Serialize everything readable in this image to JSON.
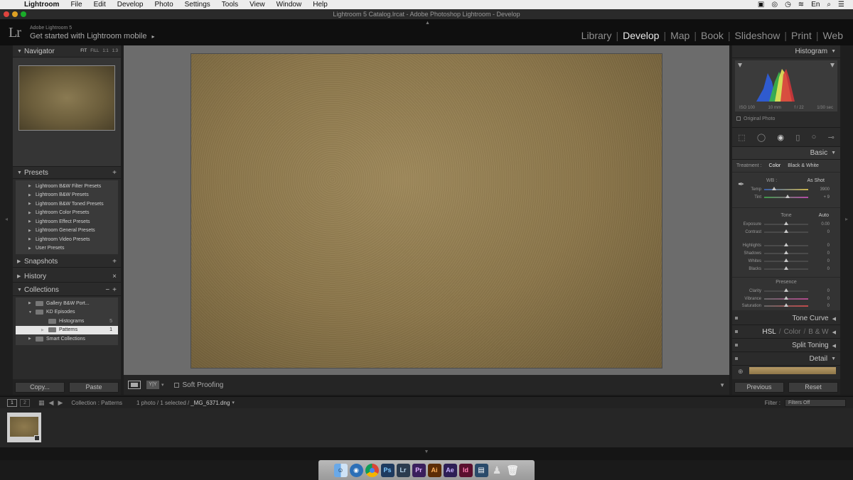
{
  "menubar": {
    "app": "Lightroom",
    "items": [
      "File",
      "Edit",
      "Develop",
      "Photo",
      "Settings",
      "Tools",
      "View",
      "Window",
      "Help"
    ],
    "input_language": "En"
  },
  "window": {
    "title": "Lightroom 5 Catalog.lrcat - Adobe Photoshop Lightroom - Develop"
  },
  "identity": {
    "logo": "Lr",
    "product": "Adobe Lightroom 5",
    "mobile_prompt": "Get started with Lightroom mobile",
    "mobile_arrow": "▸"
  },
  "modules": {
    "library": "Library",
    "develop": "Develop",
    "map": "Map",
    "book": "Book",
    "slideshow": "Slideshow",
    "print": "Print",
    "web": "Web",
    "separator": "|"
  },
  "left_panel": {
    "navigator": {
      "title": "Navigator",
      "fit": "FIT",
      "fill": "FILL",
      "one_to_one": "1:1",
      "one_to_three": "1:3"
    },
    "presets": {
      "title": "Presets",
      "items": [
        "Lightroom B&W Filter Presets",
        "Lightroom B&W Presets",
        "Lightroom B&W Toned Presets",
        "Lightroom Color Presets",
        "Lightroom Effect Presets",
        "Lightroom General Presets",
        "Lightroom Video Presets",
        "User Presets"
      ]
    },
    "snapshots": {
      "title": "Snapshots"
    },
    "history": {
      "title": "History"
    },
    "collections": {
      "title": "Collections",
      "items": {
        "gallery": {
          "label": "Gallery B&W Port..."
        },
        "kd": {
          "label": "KD Episodes"
        },
        "histograms": {
          "label": "Histograms",
          "count": "5"
        },
        "patterns": {
          "label": "Patterns",
          "count": "1"
        },
        "smart": {
          "label": "Smart Collections"
        }
      }
    },
    "buttons": {
      "copy": "Copy...",
      "paste": "Paste"
    }
  },
  "toolbar": {
    "soft_proofing": "Soft Proofing",
    "yy": "Y|Y"
  },
  "right_panel": {
    "histogram": {
      "title": "Histogram",
      "iso": "ISO 100",
      "focal": "10 mm",
      "aperture": "f / 22",
      "shutter": "1/30 sec",
      "original_photo": "Original Photo"
    },
    "basic": {
      "title": "Basic",
      "treatment_label": "Treatment :",
      "treatment_color": "Color",
      "treatment_bw": "Black & White",
      "wb_label": "WB :",
      "wb_value": "As Shot",
      "temp": {
        "label": "Temp",
        "value": "3900"
      },
      "tint": {
        "label": "Tint",
        "value": "+ 9"
      },
      "tone_label": "Tone",
      "auto": "Auto",
      "exposure": {
        "label": "Exposure",
        "value": "0.00"
      },
      "contrast": {
        "label": "Contrast",
        "value": "0"
      },
      "highlights": {
        "label": "Highlights",
        "value": "0"
      },
      "shadows": {
        "label": "Shadows",
        "value": "0"
      },
      "whites": {
        "label": "Whites",
        "value": "0"
      },
      "blacks": {
        "label": "Blacks",
        "value": "0"
      },
      "presence_label": "Presence",
      "clarity": {
        "label": "Clarity",
        "value": "0"
      },
      "vibrance": {
        "label": "Vibrance",
        "value": "0"
      },
      "saturation": {
        "label": "Saturation",
        "value": "0"
      }
    },
    "tone_curve": "Tone Curve",
    "hsl": {
      "hsl": "HSL",
      "color": "Color",
      "bw": "B & W",
      "sep": "/"
    },
    "split_toning": "Split Toning",
    "detail": "Detail",
    "buttons": {
      "previous": "Previous",
      "reset": "Reset"
    }
  },
  "filmstrip_bar": {
    "view1": "1",
    "view2": "2",
    "source": "Collection : Patterns",
    "selection": "1 photo / 1 selected /",
    "filename": "_MG_6371.dng",
    "filter_label": "Filter :",
    "filter_value": "Filters Off"
  },
  "dock": {
    "apps": [
      "Ps",
      "Lr",
      "Pr",
      "Ai",
      "Ae",
      "Id"
    ]
  },
  "colors": {
    "ps": "#1e3a5f",
    "lr": "#2b3b4f",
    "pr": "#3a1f5c",
    "ai": "#5c2d06",
    "ae": "#2d1f55",
    "id": "#5a0f2e"
  }
}
